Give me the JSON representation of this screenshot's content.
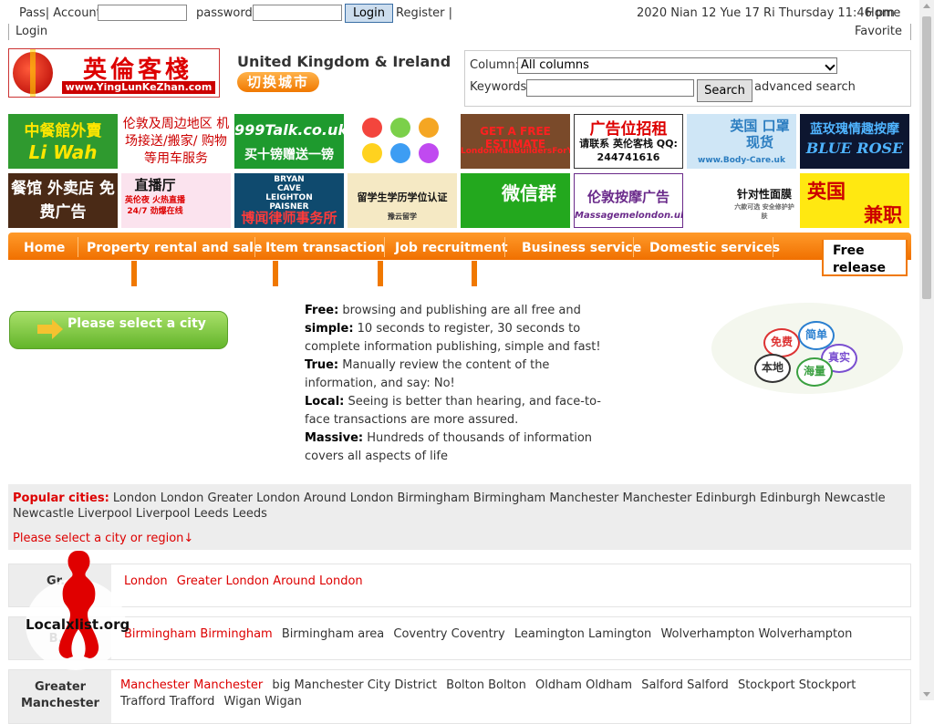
{
  "topbar": {
    "pass_account_label": "Pass| Account:",
    "password_label": "password:",
    "login_button": "Login",
    "register_link": "Register |",
    "login_link": "Login",
    "datetime": "2020 Nian 12 Yue 17 Ri Thursday 11:46 pm",
    "home_link": "Home",
    "favorite_link": "Favorite"
  },
  "header": {
    "logo_cn": "英倫客棧",
    "logo_url": "www.YingLunKeZhan.com",
    "region": "United Kingdom & Ireland",
    "switch_city": "切换城市"
  },
  "search": {
    "column_label": "Column:",
    "column_value": "All columns",
    "keywords_label": "Keywords:",
    "keywords_value": "",
    "search_button": "Search",
    "advanced_link": "advanced search"
  },
  "ads": [
    {
      "text": "中餐館外賣",
      "sub": "Li Wah"
    },
    {
      "text": "伦敦及周边地区 机场接送/搬家/ 购物等用车服务",
      "sub": ""
    },
    {
      "text": "999Talk.co.uk",
      "sub": "买十镑赠送一镑"
    },
    {
      "text": "",
      "sub": ""
    },
    {
      "text": "GET A FREE ESTIMATE",
      "sub": "LondonMaaBuildersForYou"
    },
    {
      "text": "广告位招租",
      "sub": "请联系 英伦客栈 QQ: 244741616"
    },
    {
      "text": "英国 口罩现货",
      "sub": "www.Body-Care.uk"
    },
    {
      "text": "蓝玫瑰情趣按摩",
      "sub": "BLUE ROSE"
    },
    {
      "text": "餐馆 外卖店 免费广告",
      "sub": ""
    },
    {
      "text": "直播厅",
      "sub": "英伦夜 火热直播 24/7 劲爆在线"
    },
    {
      "text": "BRYAN CAVE LEIGHTON PAISNER",
      "sub": "博闻律师事务所"
    },
    {
      "text": "留学生学历学位认证",
      "sub": "豫云留学"
    },
    {
      "text": "微信群",
      "sub": ""
    },
    {
      "text": "伦敦按摩广告",
      "sub": "Massagemelondon.uk"
    },
    {
      "text": "针对性面膜",
      "sub": "六款可选 安全修护护肤"
    },
    {
      "text": "英国",
      "sub": "兼职"
    }
  ],
  "nav": {
    "items": [
      "Home",
      "Property rental and sale",
      "Item transaction",
      "Job recruitment",
      "Business service",
      "Domestic services"
    ],
    "free_release": "Free release"
  },
  "intro": {
    "city_button": "Please select a city",
    "features": [
      {
        "term": "Free:",
        "text": " browsing and publishing are all free and"
      },
      {
        "term": "simple:",
        "text": " 10 seconds to register, 30 seconds to complete information publishing, simple and fast!"
      },
      {
        "term": "True:",
        "text": " Manually review the content of the information, and say: No!"
      },
      {
        "term": "Local:",
        "text": " Seeing is better than hearing, and face-to-face transactions are more assured."
      },
      {
        "term": "Massive:",
        "text": " Hundreds of thousands of information covers all aspects of life"
      }
    ],
    "badges": [
      "免费",
      "简单",
      "本地",
      "真实",
      "海量"
    ]
  },
  "popular": {
    "label": "Popular cities:",
    "cities": "London London Greater London Around London Birmingham Birmingham Manchester Manchester Edinburgh Edinburgh Newcastle Newcastle Liverpool Liverpool Leeds Leeds",
    "select_prompt": "Please select a city or region↓"
  },
  "regions": [
    {
      "name": "Gr...",
      "cities": [
        {
          "t": "London",
          "red": true
        },
        {
          "t": "Greater London Around London",
          "red": true
        }
      ]
    },
    {
      "name": "B...",
      "cities": [
        {
          "t": "Birmingham Birmingham",
          "red": true
        },
        {
          "t": "Birmingham area",
          "red": false
        },
        {
          "t": "Coventry Coventry",
          "red": false
        },
        {
          "t": "Leamington Lamington",
          "red": false
        },
        {
          "t": "Wolverhampton Wolverhampton",
          "red": false
        }
      ]
    },
    {
      "name": "Greater Manchester",
      "cities": [
        {
          "t": "Manchester Manchester",
          "red": true
        },
        {
          "t": "big Manchester City District",
          "red": false
        },
        {
          "t": "Bolton Bolton",
          "red": false
        },
        {
          "t": "Oldham Oldham",
          "red": false
        },
        {
          "t": "Salford Salford",
          "red": false
        },
        {
          "t": "Stockport Stockport",
          "red": false
        },
        {
          "t": "Trafford Trafford",
          "red": false
        },
        {
          "t": "Wigan Wigan",
          "red": false
        }
      ]
    }
  ],
  "watermark": "Localxlist.org",
  "colors": {
    "accent_orange": "#f07800",
    "link_red": "#dd0000",
    "green_button": "#63b52a"
  }
}
